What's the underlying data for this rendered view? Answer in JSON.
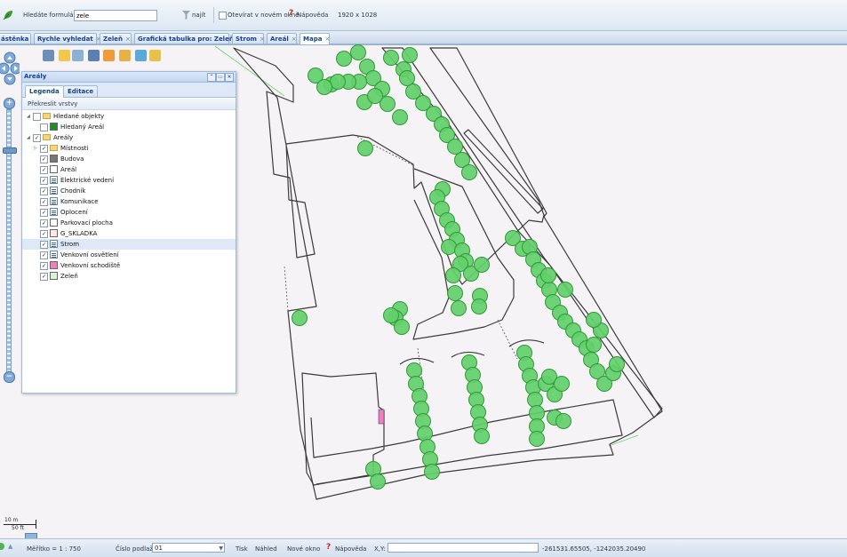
{
  "toolbar": {
    "search_label": "Hledáte formulář?",
    "search_value": "zele",
    "find_label": "najít",
    "new_window_label": "Otevírat v novém okně",
    "help_label": "Nápověda",
    "resolution": "1920 x 1028"
  },
  "tabs": [
    {
      "label": "ástěnka"
    },
    {
      "label": "Rychle vyhledat"
    },
    {
      "label": "Zeleň"
    },
    {
      "label": "Grafická tabulka pro: Zeleň"
    },
    {
      "label": "Strom"
    },
    {
      "label": "Areál"
    },
    {
      "label": "Mapa",
      "active": true
    }
  ],
  "panel": {
    "title": "Areály",
    "tabs": [
      "Legenda",
      "Editace"
    ],
    "redraw_label": "Překreslit vrstvy",
    "tree": [
      {
        "label": "Hledané objekty",
        "checked": false,
        "type": "folder",
        "expand": "open"
      },
      {
        "label": "Hledaný Areál",
        "checked": false,
        "type": "swatch",
        "color": "#1f8f2a"
      },
      {
        "label": "Areály",
        "checked": true,
        "type": "folder",
        "expand": "open"
      },
      {
        "label": "Místnosti",
        "checked": true,
        "type": "folder",
        "expand": "closed"
      },
      {
        "label": "Budova",
        "checked": true,
        "type": "swatch",
        "color": "#777777"
      },
      {
        "label": "Areál",
        "checked": true,
        "type": "swatch",
        "color": "#ffffff"
      },
      {
        "label": "Elektrické vedení",
        "checked": true,
        "type": "list"
      },
      {
        "label": "Chodník",
        "checked": true,
        "type": "list"
      },
      {
        "label": "Komunikace",
        "checked": true,
        "type": "list"
      },
      {
        "label": "Oplocení",
        "checked": true,
        "type": "list"
      },
      {
        "label": "Parkovací plocha",
        "checked": true,
        "type": "swatch",
        "color": "#ffffff"
      },
      {
        "label": "G_SKLADKA",
        "checked": true,
        "type": "swatch",
        "color": "#fde7e7"
      },
      {
        "label": "Strom",
        "checked": true,
        "type": "list",
        "selected": true
      },
      {
        "label": "Venkovní osvětlení",
        "checked": true,
        "type": "list"
      },
      {
        "label": "Venkovní schodiště",
        "checked": true,
        "type": "swatch",
        "color": "#ef7fbf"
      },
      {
        "label": "Zeleň",
        "checked": true,
        "type": "swatch",
        "color": "#d5f5d5"
      }
    ]
  },
  "scale_bar": {
    "metric": "10 m",
    "imperial": "50 ft"
  },
  "statusbar": {
    "scale_label": "Měřítko = 1 : 750",
    "floor_label": "Číslo podlaží:",
    "floor_value": "01",
    "print_label": "Tisk",
    "preview_label": "Náhled",
    "new_window_label": "Nové okno",
    "help_label": "Nápověda",
    "xy_label": "X,Y:",
    "xy_value": "",
    "coordinates": "-261531.65505, -1242035.20490"
  },
  "colors": {
    "tree_fill": "#62d06a",
    "tree_stroke": "#2f9a36",
    "outline": "#3a3a3a",
    "accent": "#15428b"
  }
}
